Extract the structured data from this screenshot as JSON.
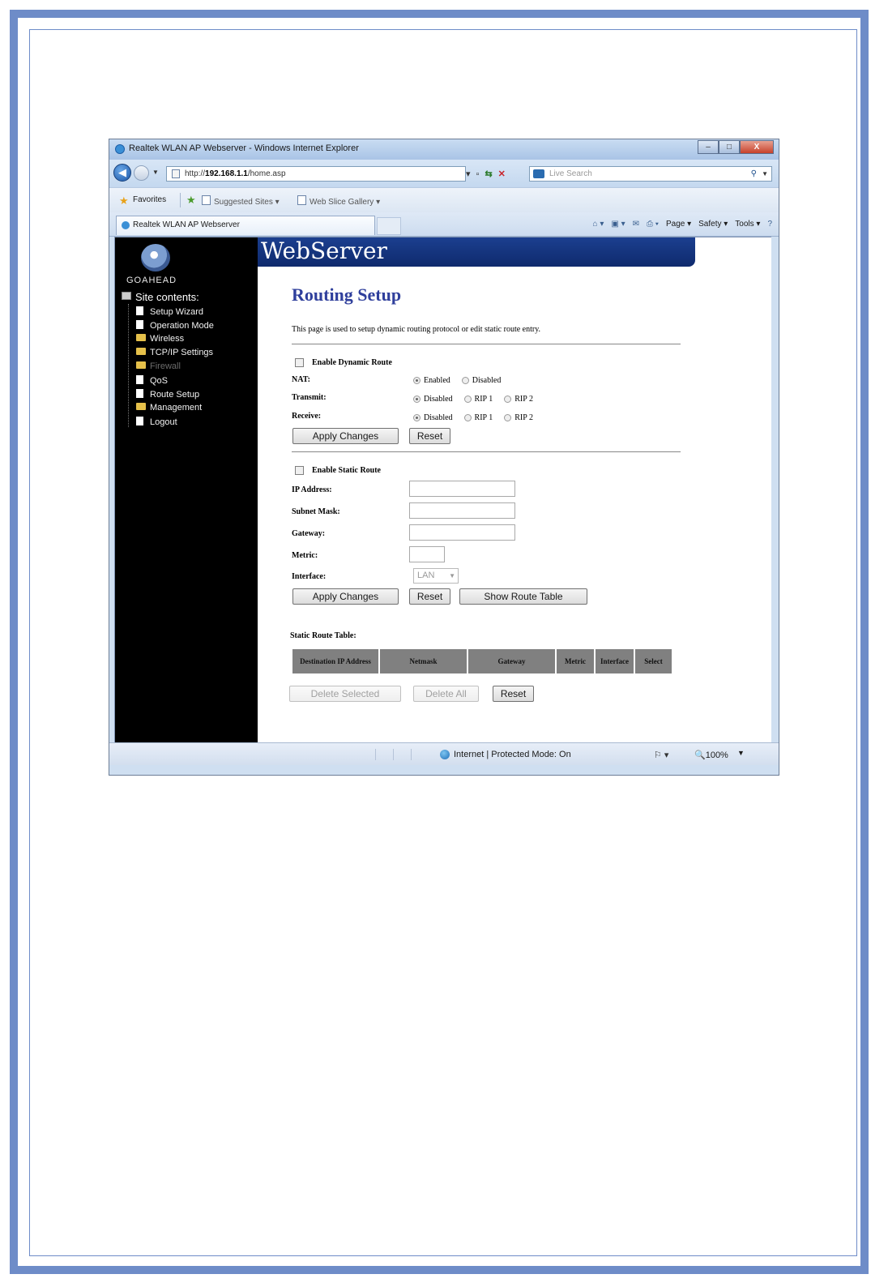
{
  "window": {
    "title": "Realtek WLAN AP Webserver - Windows Internet Explorer",
    "min_label": "–",
    "max_label": "□",
    "close_label": "X"
  },
  "address_bar": {
    "url_prefix": "http://",
    "url_host": "192.168.1.1",
    "url_path": "/home.asp",
    "search_placeholder": "Live Search"
  },
  "favorites_bar": {
    "favorites_label": "Favorites",
    "items": [
      "Suggested Sites ▾",
      "Web Slice Gallery ▾"
    ]
  },
  "tab": {
    "label": "Realtek WLAN AP Webserver"
  },
  "command_bar": {
    "page_label": "Page ▾",
    "safety_label": "Safety ▾",
    "tools_label": "Tools ▾",
    "help_label": "?"
  },
  "sidebar": {
    "brand": "GOAHEAD",
    "root_label": "Site contents:",
    "items": [
      {
        "label": "Setup Wizard",
        "icon": "document-icon"
      },
      {
        "label": "Operation Mode",
        "icon": "document-icon"
      },
      {
        "label": "Wireless",
        "icon": "folder-icon"
      },
      {
        "label": "TCP/IP Settings",
        "icon": "folder-icon"
      },
      {
        "label": "Firewall",
        "icon": "folder-icon"
      },
      {
        "label": "QoS",
        "icon": "document-icon"
      },
      {
        "label": "Route Setup",
        "icon": "document-icon"
      },
      {
        "label": "Management",
        "icon": "folder-icon"
      },
      {
        "label": "Logout",
        "icon": "document-icon"
      }
    ]
  },
  "banner": {
    "title": "WebServer"
  },
  "main": {
    "heading": "Routing Setup",
    "intro": "This page is used to setup dynamic routing protocol or edit static route entry.",
    "dynamic": {
      "enable_label": "Enable Dynamic Route",
      "nat_label": "NAT:",
      "nat_options": [
        "Enabled",
        "Disabled"
      ],
      "transmit_label": "Transmit:",
      "receive_label": "Receive:",
      "rip_options": [
        "Disabled",
        "RIP 1",
        "RIP 2"
      ],
      "apply_label": "Apply Changes",
      "reset_label": "Reset"
    },
    "static": {
      "enable_label": "Enable Static Route",
      "ip_label": "IP Address:",
      "mask_label": "Subnet Mask:",
      "gateway_label": "Gateway:",
      "metric_label": "Metric:",
      "interface_label": "Interface:",
      "interface_value": "LAN",
      "apply_label": "Apply Changes",
      "reset_label": "Reset",
      "show_table_label": "Show Route Table"
    },
    "route_table": {
      "title": "Static Route Table:",
      "headers": [
        "Destination IP Address",
        "Netmask",
        "Gateway",
        "Metric",
        "Interface",
        "Select"
      ],
      "delete_selected_label": "Delete Selected",
      "delete_all_label": "Delete All",
      "reset_label": "Reset"
    }
  },
  "status_bar": {
    "zone": "Internet | Protected Mode: On",
    "zoom": "100%"
  },
  "colors": {
    "page_frame": "#6e8cc8",
    "banner": "#1b3f8f",
    "heading": "#2f3f9c",
    "sidebar_bg": "#000000"
  }
}
